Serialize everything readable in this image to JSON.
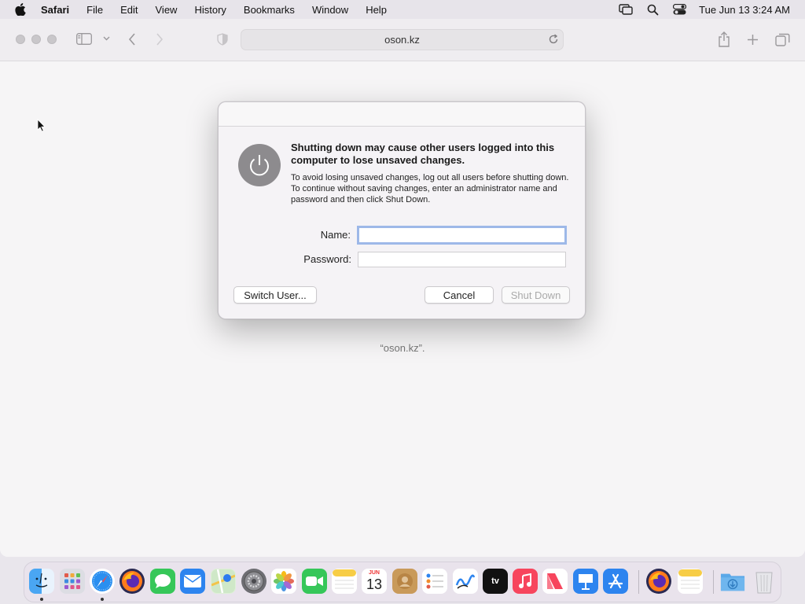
{
  "menubar": {
    "items": [
      "Safari",
      "File",
      "Edit",
      "View",
      "History",
      "Bookmarks",
      "Window",
      "Help"
    ],
    "clock": "Tue Jun 13  3:24 AM"
  },
  "browser": {
    "address": "oson.kz",
    "error_text": "“oson.kz”."
  },
  "dialog": {
    "title": "Shutting down may cause other users logged into this computer to lose unsaved changes.",
    "body": "To avoid losing unsaved changes, log out all users before shutting down. To continue without saving changes, enter an administrator name and password and then click Shut Down.",
    "name_label": "Name:",
    "password_label": "Password:",
    "name_value": "",
    "password_value": "",
    "switch_user": "Switch User...",
    "cancel": "Cancel",
    "shut_down": "Shut Down"
  },
  "dock": {
    "items": [
      "finder",
      "launchpad",
      "safari",
      "firefox",
      "messages",
      "mail",
      "maps",
      "system-preferences",
      "photos",
      "facetime",
      "notes",
      "calendar",
      "contacts",
      "reminders",
      "freeform",
      "tv",
      "music",
      "news",
      "keynote",
      "app-store",
      "firefox",
      "notes",
      "downloads",
      "trash"
    ],
    "calendar_month": "JUN",
    "calendar_day": "13",
    "tv_label": "tv"
  }
}
